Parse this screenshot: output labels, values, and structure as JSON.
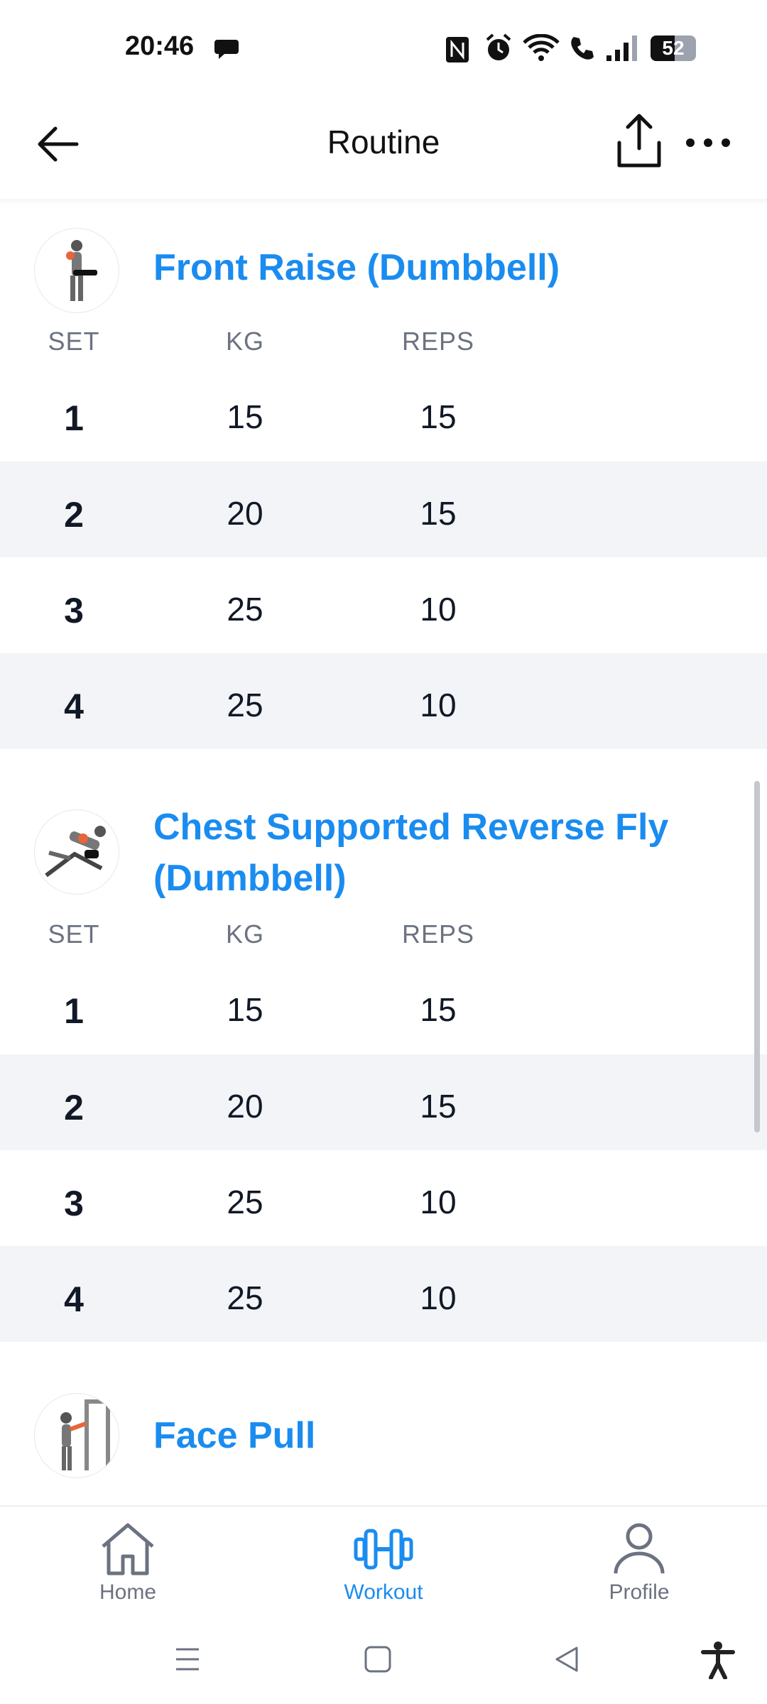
{
  "status_bar": {
    "time": "20:46",
    "battery": "52"
  },
  "header": {
    "title": "Routine"
  },
  "columns": {
    "set": "SET",
    "kg": "KG",
    "reps": "REPS"
  },
  "exercises": [
    {
      "name": "Front Raise (Dumbbell)",
      "sets": [
        {
          "set": "1",
          "kg": "15",
          "reps": "15"
        },
        {
          "set": "2",
          "kg": "20",
          "reps": "15"
        },
        {
          "set": "3",
          "kg": "25",
          "reps": "10"
        },
        {
          "set": "4",
          "kg": "25",
          "reps": "10"
        }
      ]
    },
    {
      "name": "Chest Supported Reverse Fly (Dumbbell)",
      "sets": [
        {
          "set": "1",
          "kg": "15",
          "reps": "15"
        },
        {
          "set": "2",
          "kg": "20",
          "reps": "15"
        },
        {
          "set": "3",
          "kg": "25",
          "reps": "10"
        },
        {
          "set": "4",
          "kg": "25",
          "reps": "10"
        }
      ]
    },
    {
      "name": "Face Pull"
    }
  ],
  "bottom_nav": {
    "home": "Home",
    "workout": "Workout",
    "profile": "Profile"
  },
  "colors": {
    "accent": "#1a8cf0",
    "row_alt": "#f2f4f7"
  }
}
